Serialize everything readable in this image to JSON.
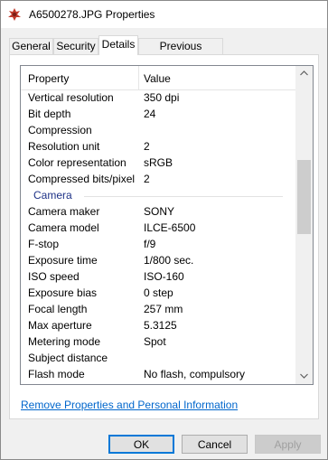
{
  "window": {
    "title": "A6500278.JPG Properties",
    "icon": "image-file-icon"
  },
  "tabs": [
    {
      "label": "General",
      "active": false
    },
    {
      "label": "Security",
      "active": false
    },
    {
      "label": "Details",
      "active": true
    },
    {
      "label": "Previous Versions",
      "active": false
    }
  ],
  "list": {
    "header": {
      "property": "Property",
      "value": "Value"
    },
    "rows_before": [
      {
        "name": "Vertical resolution",
        "value": "350 dpi"
      },
      {
        "name": "Bit depth",
        "value": "24"
      },
      {
        "name": "Compression",
        "value": ""
      },
      {
        "name": "Resolution unit",
        "value": "2"
      },
      {
        "name": "Color representation",
        "value": "sRGB"
      },
      {
        "name": "Compressed bits/pixel",
        "value": "2"
      }
    ],
    "group_label": "Camera",
    "rows_after": [
      {
        "name": "Camera maker",
        "value": "SONY"
      },
      {
        "name": "Camera model",
        "value": "ILCE-6500"
      },
      {
        "name": "F-stop",
        "value": "f/9"
      },
      {
        "name": "Exposure time",
        "value": "1/800 sec."
      },
      {
        "name": "ISO speed",
        "value": "ISO-160"
      },
      {
        "name": "Exposure bias",
        "value": "0 step"
      },
      {
        "name": "Focal length",
        "value": "257 mm"
      },
      {
        "name": "Max aperture",
        "value": "5.3125"
      },
      {
        "name": "Metering mode",
        "value": "Spot"
      },
      {
        "name": "Subject distance",
        "value": ""
      },
      {
        "name": "Flash mode",
        "value": "No flash, compulsory"
      }
    ]
  },
  "link": {
    "remove_properties": "Remove Properties and Personal Information"
  },
  "buttons": {
    "ok": "OK",
    "cancel": "Cancel",
    "apply": "Apply"
  }
}
